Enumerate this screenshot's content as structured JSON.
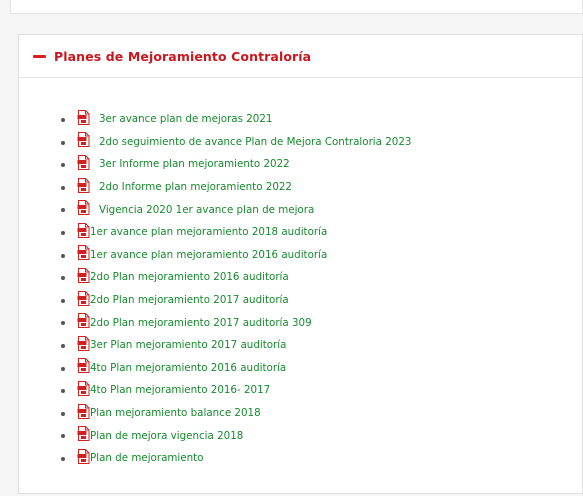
{
  "panel": {
    "title": "Planes de Mejoramiento Contraloría",
    "items": [
      {
        "label": "3er avance plan de mejoras 2021",
        "spaced": true
      },
      {
        "label": "2do seguimiento de avance Plan de Mejora Contraloria 2023",
        "spaced": true
      },
      {
        "label": "3er Informe plan mejoramiento 2022",
        "spaced": true
      },
      {
        "label": "2do Informe plan mejoramiento 2022",
        "spaced": true
      },
      {
        "label": "Vigencia 2020 1er avance plan de mejora",
        "spaced": true
      },
      {
        "label": "1er avance plan mejoramiento 2018 auditoría",
        "spaced": false
      },
      {
        "label": "1er avance plan mejoramiento 2016 auditoría",
        "spaced": false
      },
      {
        "label": "2do Plan mejoramiento 2016 auditoría",
        "spaced": false
      },
      {
        "label": "2do Plan mejoramiento 2017 auditoría",
        "spaced": false
      },
      {
        "label": "2do Plan mejoramiento 2017 auditoría 309",
        "spaced": false
      },
      {
        "label": "3er Plan mejoramiento 2017 auditoría",
        "spaced": false
      },
      {
        "label": "4to Plan mejoramiento 2016 auditoría",
        "spaced": false
      },
      {
        "label": "4to Plan mejoramiento 2016- 2017",
        "spaced": false
      },
      {
        "label": "Plan mejoramiento balance 2018",
        "spaced": false
      },
      {
        "label": "Plan de mejora vigencia 2018",
        "spaced": false
      },
      {
        "label": "Plan de mejoramiento",
        "spaced": false
      }
    ]
  },
  "colors": {
    "title": "#c8181e",
    "link": "#178a2e",
    "pdf_icon": "#d21f1f"
  },
  "icons": {
    "collapse": "minus-icon",
    "document": "pdf-file-icon"
  }
}
